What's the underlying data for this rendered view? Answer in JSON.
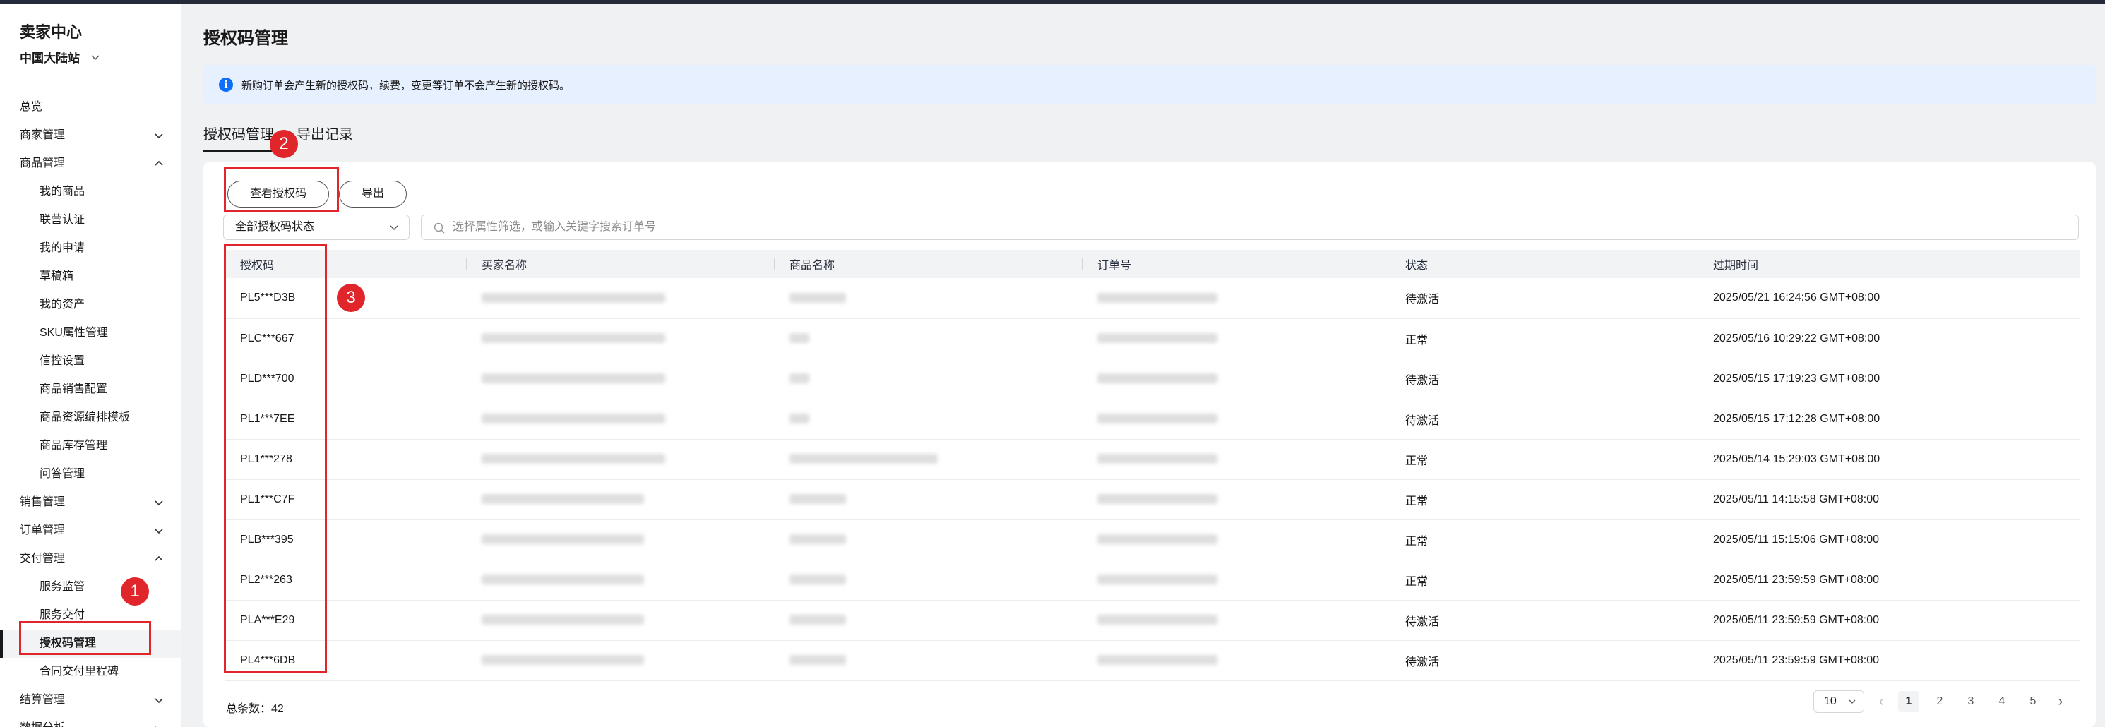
{
  "sidebar": {
    "brand": "卖家中心",
    "station": "中国大陆站",
    "items": [
      {
        "label": "总览",
        "type": "top"
      },
      {
        "label": "商家管理",
        "type": "group",
        "arrow": "down"
      },
      {
        "label": "商品管理",
        "type": "group",
        "arrow": "up"
      },
      {
        "label": "我的商品",
        "type": "sub"
      },
      {
        "label": "联营认证",
        "type": "sub"
      },
      {
        "label": "我的申请",
        "type": "sub"
      },
      {
        "label": "草稿箱",
        "type": "sub"
      },
      {
        "label": "我的资产",
        "type": "sub"
      },
      {
        "label": "SKU属性管理",
        "type": "sub"
      },
      {
        "label": "信控设置",
        "type": "sub"
      },
      {
        "label": "商品销售配置",
        "type": "sub"
      },
      {
        "label": "商品资源编排模板",
        "type": "sub"
      },
      {
        "label": "商品库存管理",
        "type": "sub"
      },
      {
        "label": "问答管理",
        "type": "sub"
      },
      {
        "label": "销售管理",
        "type": "group",
        "arrow": "down"
      },
      {
        "label": "订单管理",
        "type": "group",
        "arrow": "down"
      },
      {
        "label": "交付管理",
        "type": "group",
        "arrow": "up"
      },
      {
        "label": "服务监管",
        "type": "sub"
      },
      {
        "label": "服务交付",
        "type": "sub"
      },
      {
        "label": "授权码管理",
        "type": "sub",
        "active": true
      },
      {
        "label": "合同交付里程碑",
        "type": "sub"
      },
      {
        "label": "结算管理",
        "type": "group",
        "arrow": "down"
      },
      {
        "label": "数据分析",
        "type": "group",
        "arrow": "down"
      }
    ]
  },
  "page": {
    "title": "授权码管理",
    "notice": "新购订单会产生新的授权码，续费，变更等订单不会产生新的授权码。",
    "tabs": [
      "授权码管理",
      "导出记录"
    ]
  },
  "toolbar": {
    "view_button": "查看授权码",
    "export_button": "导出",
    "status_select": "全部授权码状态",
    "search_placeholder": "选择属性筛选，或输入关键字搜索订单号"
  },
  "table": {
    "columns": [
      "授权码",
      "买家名称",
      "商品名称",
      "订单号",
      "状态",
      "过期时间"
    ],
    "rows": [
      {
        "code": "PL5***D3B",
        "status": "待激活",
        "expire": "2025/05/21 16:24:56 GMT+08:00"
      },
      {
        "code": "PLC***667",
        "status": "正常",
        "expire": "2025/05/16 10:29:22 GMT+08:00"
      },
      {
        "code": "PLD***700",
        "status": "待激活",
        "expire": "2025/05/15 17:19:23 GMT+08:00"
      },
      {
        "code": "PL1***7EE",
        "status": "待激活",
        "expire": "2025/05/15 17:12:28 GMT+08:00"
      },
      {
        "code": "PL1***278",
        "status": "正常",
        "expire": "2025/05/14 15:29:03 GMT+08:00"
      },
      {
        "code": "PL1***C7F",
        "status": "正常",
        "expire": "2025/05/11 14:15:58 GMT+08:00"
      },
      {
        "code": "PLB***395",
        "status": "正常",
        "expire": "2025/05/11 15:15:06 GMT+08:00"
      },
      {
        "code": "PL2***263",
        "status": "正常",
        "expire": "2025/05/11 23:59:59 GMT+08:00"
      },
      {
        "code": "PLA***E29",
        "status": "待激活",
        "expire": "2025/05/11 23:59:59 GMT+08:00"
      },
      {
        "code": "PL4***6DB",
        "status": "待激活",
        "expire": "2025/05/11 23:59:59 GMT+08:00"
      }
    ]
  },
  "footer": {
    "total_label": "总条数：42",
    "page_size": "10",
    "pages": [
      "1",
      "2",
      "3",
      "4",
      "5"
    ],
    "current_page": "1"
  },
  "annotations": [
    "1",
    "2",
    "3"
  ],
  "colors": {
    "highlight": "#e0252b",
    "info": "#0d6ef7"
  }
}
